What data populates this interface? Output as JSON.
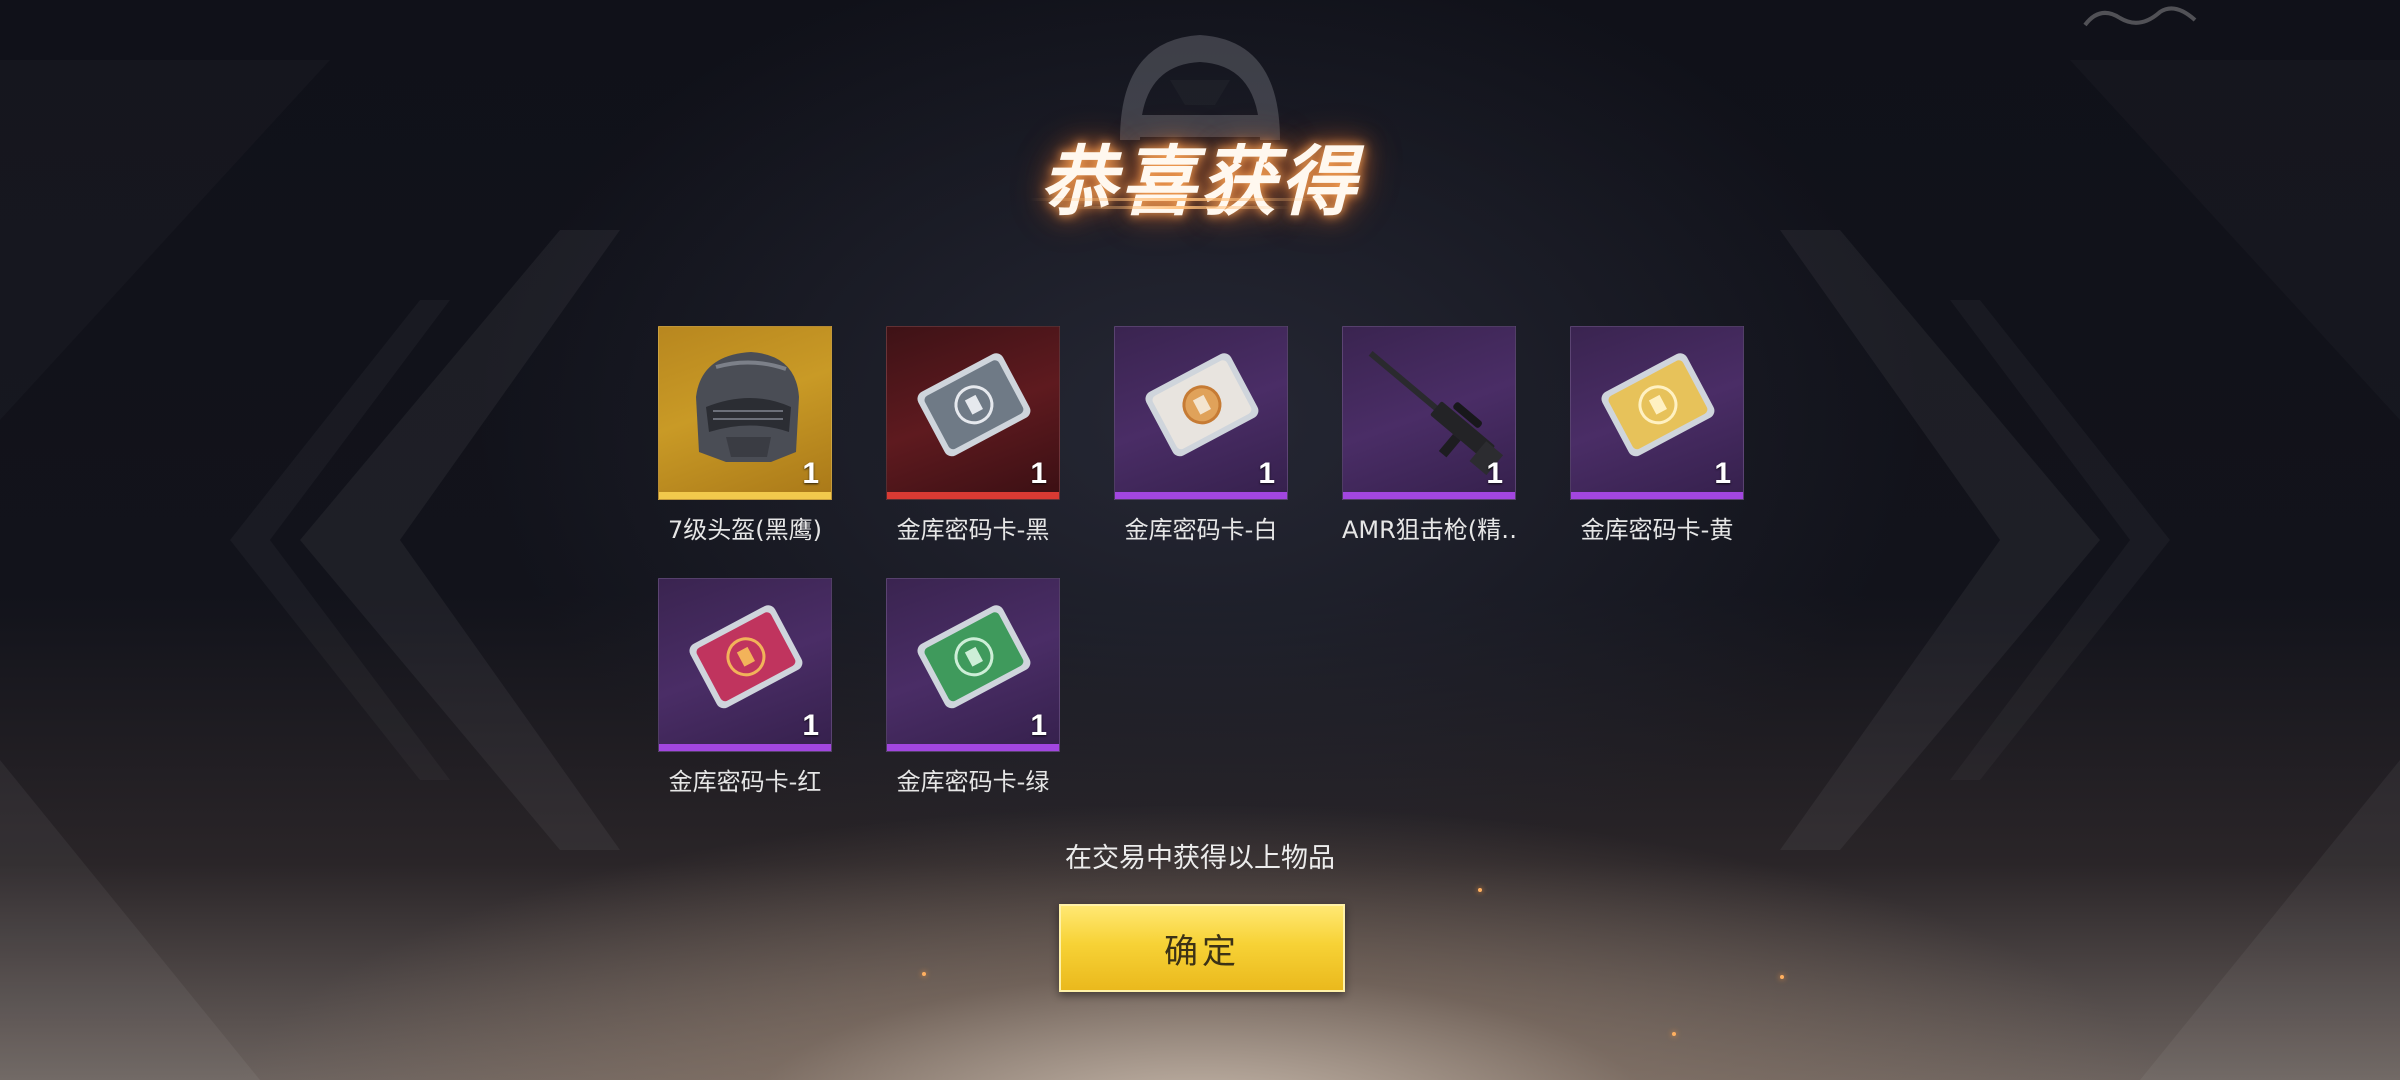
{
  "dialog": {
    "title": "恭喜获得",
    "note": "在交易中获得以上物品",
    "confirm_label": "确定"
  },
  "items": [
    {
      "name": "7级头盔(黑鹰)",
      "count": "1",
      "rarity": "gold",
      "icon": "helmet-icon"
    },
    {
      "name": "金库密码卡-黑",
      "count": "1",
      "rarity": "red",
      "icon": "vault-card-icon",
      "card_color": "#6f7a86"
    },
    {
      "name": "金库密码卡-白",
      "count": "1",
      "rarity": "purple",
      "icon": "vault-card-icon",
      "card_color": "#e8e4df"
    },
    {
      "name": "AMR狙击枪(精…",
      "count": "1",
      "rarity": "purple",
      "icon": "sniper-rifle-icon"
    },
    {
      "name": "金库密码卡-黄",
      "count": "1",
      "rarity": "purple",
      "icon": "vault-card-icon",
      "card_color": "#e7c25a"
    },
    {
      "name": "金库密码卡-红",
      "count": "1",
      "rarity": "purple",
      "icon": "vault-card-icon",
      "card_color": "#c0345e"
    },
    {
      "name": "金库密码卡-绿",
      "count": "1",
      "rarity": "purple",
      "icon": "vault-card-icon",
      "card_color": "#3f9a5c"
    }
  ],
  "colors": {
    "gold_rarity": "#f2c94c",
    "red_rarity": "#d93a33",
    "purple_rarity": "#a246e0",
    "confirm_button": "#f7d236"
  }
}
